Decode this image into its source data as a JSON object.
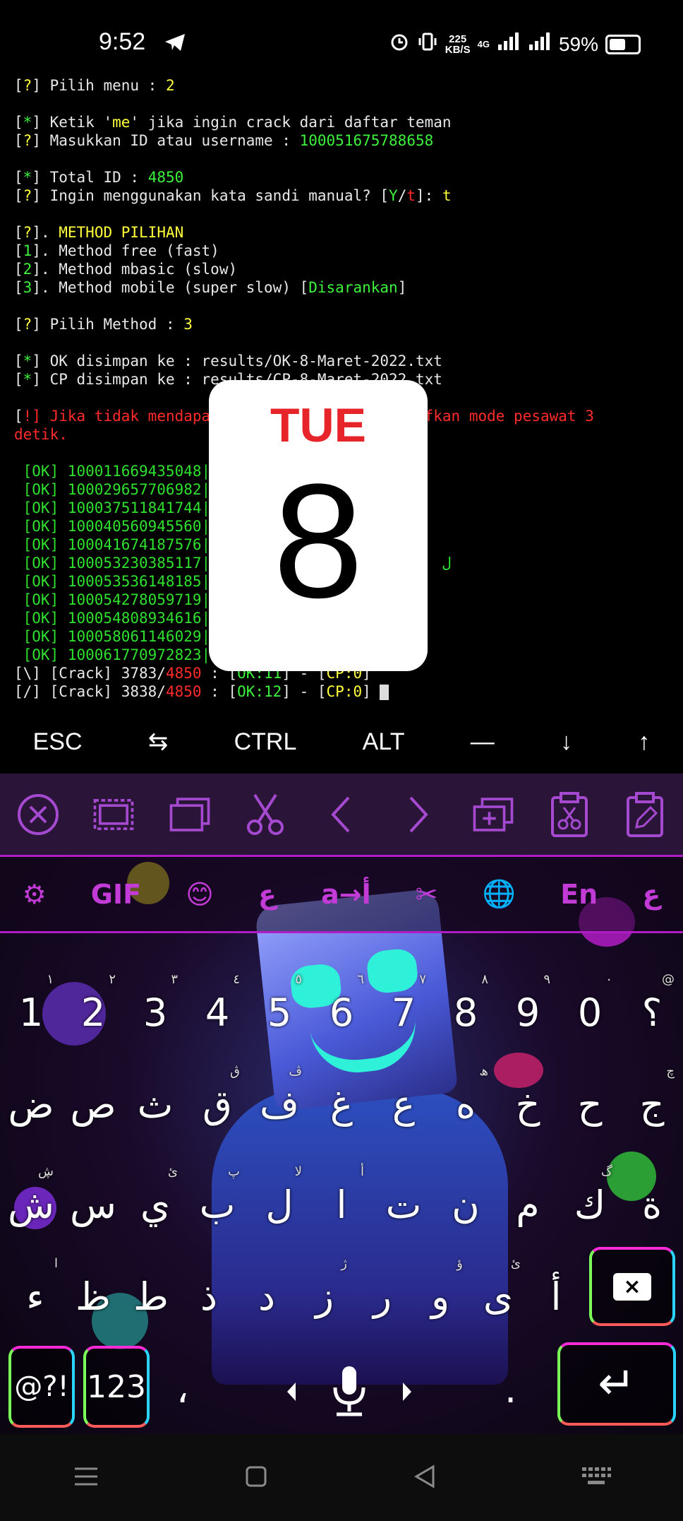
{
  "status_bar": {
    "time": "9:52",
    "net_speed_value": "225",
    "net_speed_unit": "KB/S",
    "network_type": "4G",
    "battery_percent": "59%",
    "battery_level": 0.59
  },
  "terminal": {
    "lines": [
      [
        {
          "t": "[",
          "c": "w"
        },
        {
          "t": "?",
          "c": "y"
        },
        {
          "t": "] Pilih menu : ",
          "c": "w"
        },
        {
          "t": "2",
          "c": "y"
        }
      ],
      [],
      [
        {
          "t": "[",
          "c": "w"
        },
        {
          "t": "*",
          "c": "g"
        },
        {
          "t": "] Ketik '",
          "c": "w"
        },
        {
          "t": "me",
          "c": "y"
        },
        {
          "t": "' jika ingin crack dari daftar teman",
          "c": "w"
        }
      ],
      [
        {
          "t": "[",
          "c": "w"
        },
        {
          "t": "?",
          "c": "y"
        },
        {
          "t": "] Masukkan ID atau username : ",
          "c": "w"
        },
        {
          "t": "100051675788658",
          "c": "g"
        }
      ],
      [],
      [
        {
          "t": "[",
          "c": "w"
        },
        {
          "t": "*",
          "c": "g"
        },
        {
          "t": "] Total ID : ",
          "c": "w"
        },
        {
          "t": "4850",
          "c": "g"
        }
      ],
      [
        {
          "t": "[",
          "c": "w"
        },
        {
          "t": "?",
          "c": "y"
        },
        {
          "t": "] Ingin menggunakan kata sandi manual? [",
          "c": "w"
        },
        {
          "t": "Y",
          "c": "g"
        },
        {
          "t": "/",
          "c": "w"
        },
        {
          "t": "t",
          "c": "r"
        },
        {
          "t": "]: ",
          "c": "w"
        },
        {
          "t": "t",
          "c": "y"
        }
      ],
      [],
      [
        {
          "t": "[",
          "c": "w"
        },
        {
          "t": "?",
          "c": "y"
        },
        {
          "t": "]. ",
          "c": "w"
        },
        {
          "t": "METHOD PILIHAN",
          "c": "y"
        }
      ],
      [
        {
          "t": "[",
          "c": "w"
        },
        {
          "t": "1",
          "c": "g"
        },
        {
          "t": "]. Method free (fast)",
          "c": "w"
        }
      ],
      [
        {
          "t": "[",
          "c": "w"
        },
        {
          "t": "2",
          "c": "g"
        },
        {
          "t": "]. Method mbasic (slow)",
          "c": "w"
        }
      ],
      [
        {
          "t": "[",
          "c": "w"
        },
        {
          "t": "3",
          "c": "g"
        },
        {
          "t": "]. Method mobile (super slow) [",
          "c": "w"
        },
        {
          "t": "Disarankan",
          "c": "g"
        },
        {
          "t": "]",
          "c": "w"
        }
      ],
      [],
      [
        {
          "t": "[",
          "c": "w"
        },
        {
          "t": "?",
          "c": "y"
        },
        {
          "t": "] Pilih Method : ",
          "c": "w"
        },
        {
          "t": "3",
          "c": "y"
        }
      ],
      [],
      [
        {
          "t": "[",
          "c": "w"
        },
        {
          "t": "*",
          "c": "g"
        },
        {
          "t": "] OK disimpan ke : results/OK-8-Maret-2022.txt",
          "c": "w"
        }
      ],
      [
        {
          "t": "[",
          "c": "w"
        },
        {
          "t": "*",
          "c": "g"
        },
        {
          "t": "] CP disimpan ke : results/CP-8-Maret-2022.txt",
          "c": "w"
        }
      ],
      [],
      [
        {
          "t": "[",
          "c": "w"
        },
        {
          "t": "!",
          "c": "r"
        },
        {
          "t": "] Jika tidak mendapa",
          "c": "r"
        },
        {
          "t": "               ",
          "c": "w"
        },
        {
          "t": "ama, aktifkan mode pesawat 3",
          "c": "r"
        }
      ],
      [
        {
          "t": "detik.",
          "c": "r"
        }
      ],
      [],
      [
        {
          "t": " [OK] 100011669435048|",
          "c": "ok"
        }
      ],
      [
        {
          "t": " [OK] 100029657706982|",
          "c": "ok"
        }
      ],
      [
        {
          "t": " [OK] 100037511841744|",
          "c": "ok"
        }
      ],
      [
        {
          "t": " [OK] 100040560945560|",
          "c": "ok"
        }
      ],
      [
        {
          "t": " [OK] 100041674187576|",
          "c": "ok"
        }
      ],
      [
        {
          "t": " [OK] 100053230385117|",
          "c": "ok"
        },
        {
          "t": "                          ل",
          "c": "ok"
        }
      ],
      [
        {
          "t": " [OK] 100053536148185|",
          "c": "ok"
        }
      ],
      [
        {
          "t": " [OK] 100054278059719|",
          "c": "ok"
        }
      ],
      [
        {
          "t": " [OK] 100054808934616|",
          "c": "ok"
        }
      ],
      [
        {
          "t": " [OK] 100058061146029|",
          "c": "ok"
        }
      ],
      [
        {
          "t": " [OK] 100061770972823|",
          "c": "ok"
        }
      ],
      [
        {
          "t": "[\\] [Crack] 3783/",
          "c": "w"
        },
        {
          "t": "4850",
          "c": "r"
        },
        {
          "t": " : [",
          "c": "w"
        },
        {
          "t": "OK:11",
          "c": "g"
        },
        {
          "t": "] - [",
          "c": "w"
        },
        {
          "t": "CP:0",
          "c": "y"
        },
        {
          "t": "]",
          "c": "w"
        }
      ],
      [
        {
          "t": "[/] [Crack] 3838/",
          "c": "w"
        },
        {
          "t": "4850",
          "c": "r"
        },
        {
          "t": " : [",
          "c": "w"
        },
        {
          "t": "OK:12",
          "c": "g"
        },
        {
          "t": "] - [",
          "c": "w"
        },
        {
          "t": "CP:0",
          "c": "y"
        },
        {
          "t": "] ",
          "c": "w"
        }
      ]
    ]
  },
  "calendar": {
    "day": "TUE",
    "date": "8"
  },
  "extra_keys": [
    "ESC",
    "⇆",
    "CTRL",
    "ALT",
    "—",
    "↓",
    "↑"
  ],
  "suggestion_bar": [
    "⚙",
    "GIF",
    "😊",
    "ع",
    "a→أ",
    "✂",
    "🌐",
    "En",
    "ع"
  ],
  "keyboard": {
    "row_numbers": [
      {
        "k": "1",
        "h": "١"
      },
      {
        "k": "2",
        "h": "٢"
      },
      {
        "k": "3",
        "h": "٣"
      },
      {
        "k": "4",
        "h": "٤"
      },
      {
        "k": "5",
        "h": "٥"
      },
      {
        "k": "6",
        "h": "٦"
      },
      {
        "k": "7",
        "h": "٧"
      },
      {
        "k": "8",
        "h": "٨"
      },
      {
        "k": "9",
        "h": "٩"
      },
      {
        "k": "0",
        "h": "٠"
      },
      {
        "k": "؟",
        "h": "@"
      }
    ],
    "row1": [
      {
        "k": "ض",
        "h": ""
      },
      {
        "k": "ص",
        "h": ""
      },
      {
        "k": "ث",
        "h": ""
      },
      {
        "k": "ق",
        "h": "ڨ"
      },
      {
        "k": "ف",
        "h": "ڤ"
      },
      {
        "k": "غ",
        "h": ""
      },
      {
        "k": "ع",
        "h": ""
      },
      {
        "k": "ه",
        "h": "ھ"
      },
      {
        "k": "خ",
        "h": ""
      },
      {
        "k": "ح",
        "h": ""
      },
      {
        "k": "ج",
        "h": "چ"
      }
    ],
    "row2": [
      {
        "k": "ش",
        "h": "ڜ"
      },
      {
        "k": "س",
        "h": ""
      },
      {
        "k": "ي",
        "h": "ئ"
      },
      {
        "k": "ب",
        "h": "پ"
      },
      {
        "k": "ل",
        "h": "لا"
      },
      {
        "k": "ا",
        "h": "أ"
      },
      {
        "k": "ت",
        "h": ""
      },
      {
        "k": "ن",
        "h": ""
      },
      {
        "k": "م",
        "h": ""
      },
      {
        "k": "ك",
        "h": "گ"
      },
      {
        "k": "ة",
        "h": ""
      }
    ],
    "row3": [
      {
        "k": "ء",
        "h": "ا"
      },
      {
        "k": "ظ",
        "h": ""
      },
      {
        "k": "ط",
        "h": ""
      },
      {
        "k": "ذ",
        "h": ""
      },
      {
        "k": "د",
        "h": ""
      },
      {
        "k": "ز",
        "h": "ژ"
      },
      {
        "k": "ر",
        "h": ""
      },
      {
        "k": "و",
        "h": "ؤ"
      },
      {
        "k": "ى",
        "h": "ئ"
      },
      {
        "k": "أ",
        "h": ""
      }
    ],
    "symbols_key": "@?!",
    "numbers_key": "123",
    "comma_key": "،",
    "period_key": ".",
    "backspace_glyph": "×",
    "enter_glyph": "↵"
  },
  "colors": {
    "ok_green": "#2fe02f",
    "warn_red": "#ff2b2b",
    "prompt_yellow": "#ffff3c",
    "toolbar_purple": "#a54ad0",
    "calendar_red": "#e8242b"
  }
}
